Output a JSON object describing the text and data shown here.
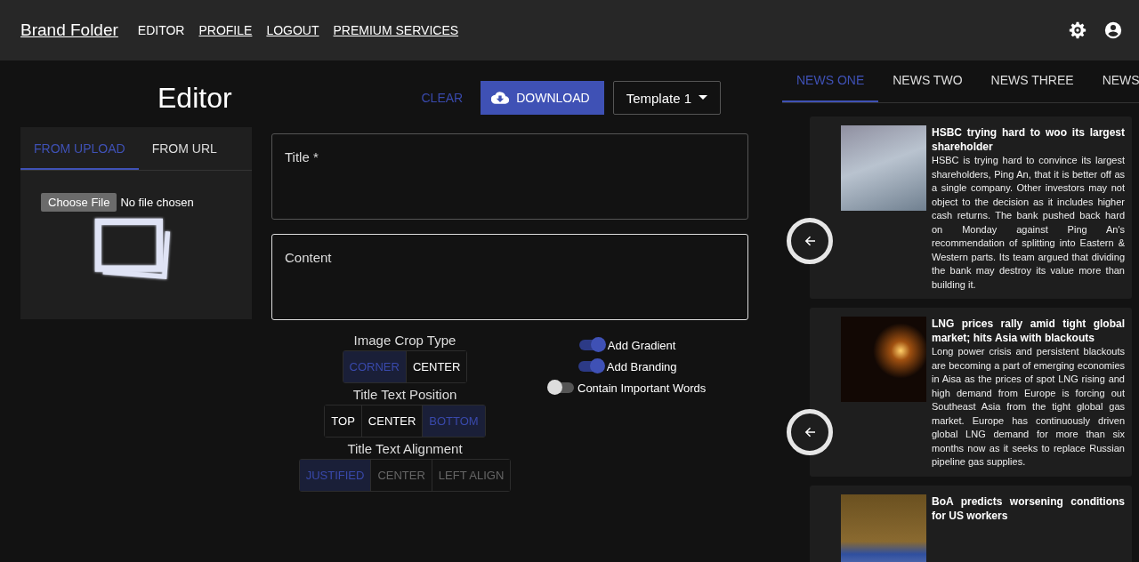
{
  "header": {
    "brand": "Brand Folder",
    "nav": [
      {
        "label": "EDITOR",
        "selected": true
      },
      {
        "label": "PROFILE",
        "selected": false
      },
      {
        "label": "LOGOUT",
        "selected": false
      },
      {
        "label": "PREMIUM SERVICES",
        "selected": false
      }
    ]
  },
  "editor": {
    "heading": "Editor",
    "clear": "CLEAR",
    "download": "DOWNLOAD",
    "template": "Template 1"
  },
  "upload": {
    "tabs": [
      {
        "label": "FROM UPLOAD",
        "selected": true
      },
      {
        "label": "FROM URL",
        "selected": false
      }
    ],
    "choose_button": "Choose File",
    "file_status": "No file chosen"
  },
  "fields": [
    {
      "label": "Title *",
      "focused": false
    },
    {
      "label": "Content",
      "focused": true
    }
  ],
  "option_groups": [
    {
      "label": "Image Crop Type",
      "options": [
        {
          "label": "CORNER",
          "selected": true,
          "disabled": false
        },
        {
          "label": "CENTER",
          "selected": false,
          "disabled": false
        }
      ]
    },
    {
      "label": "Title Text Position",
      "options": [
        {
          "label": "TOP",
          "selected": false,
          "disabled": false
        },
        {
          "label": "CENTER",
          "selected": false,
          "disabled": false
        },
        {
          "label": "BOTTOM",
          "selected": true,
          "disabled": false
        }
      ]
    },
    {
      "label": "Title Text Alignment",
      "options": [
        {
          "label": "JUSTIFIED",
          "selected": true,
          "disabled": false
        },
        {
          "label": "CENTER",
          "selected": false,
          "disabled": true
        },
        {
          "label": "LEFT ALIGN",
          "selected": false,
          "disabled": true
        }
      ]
    }
  ],
  "toggles": [
    {
      "label": "Add Gradient",
      "on": true
    },
    {
      "label": "Add Branding",
      "on": true
    },
    {
      "label": "Contain Important Words",
      "on": false
    }
  ],
  "news": {
    "tabs": [
      {
        "label": "NEWS ONE",
        "selected": true
      },
      {
        "label": "NEWS TWO",
        "selected": false
      },
      {
        "label": "NEWS THREE",
        "selected": false
      },
      {
        "label": "NEWS",
        "selected": false
      }
    ],
    "articles": [
      {
        "kind": "building",
        "title": "HSBC trying hard to woo its largest shareholder",
        "body": "HSBC is trying hard to convince its largest shareholders, Ping An, that it is better off as a single company. Other investors may not object to the decision as it includes higher cash returns. The bank pushed back hard on Monday against Ping An's recommendation of splitting into Eastern & Western parts. Its team argued that dividing the bank may destroy its value more than building it."
      },
      {
        "kind": "candle",
        "title": "LNG prices rally amid tight global market; hits Asia with blackouts",
        "body": "Long power crisis and persistent blackouts are becoming a part of emerging economies in Aisa as the prices of spot LNG rising and high demand from Europe is forcing out Southeast Asia from the tight global gas market. Europe has continuously driven global LNG demand for more than six months now as it seeks to replace Russian pipeline gas supplies."
      },
      {
        "kind": "sign",
        "title": "BoA predicts worsening conditions for US workers"
      }
    ]
  }
}
